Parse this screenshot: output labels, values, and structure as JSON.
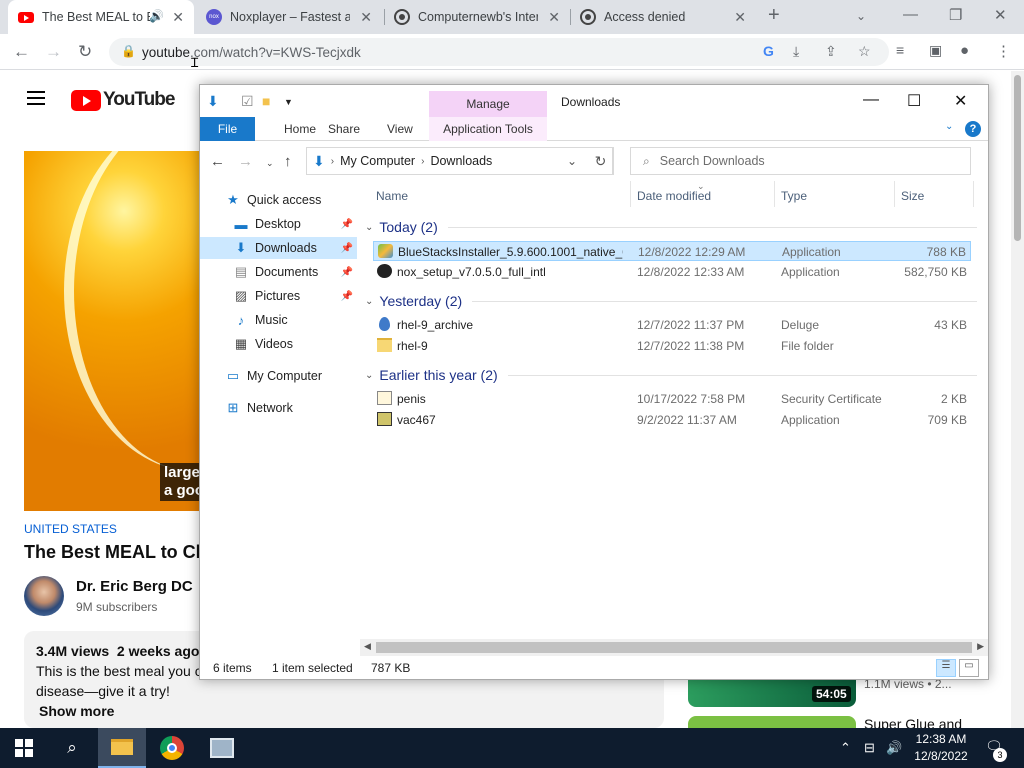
{
  "browser": {
    "tabs": [
      {
        "title": "The Best MEAL to E",
        "active": true
      },
      {
        "title": "Noxplayer – Fastest and",
        "active": false
      },
      {
        "title": "Computernewb's Interne",
        "active": false
      },
      {
        "title": "Access denied",
        "active": false
      }
    ],
    "url_host": "youtube",
    "url_rest": ".com/watch?v=KWS-Tecjxdk"
  },
  "youtube": {
    "logo_text": "YouTube",
    "caption": "large\na goo",
    "country": "UNITED STATES",
    "title": "The Best MEAL to Cl",
    "channel": "Dr. Eric Berg DC",
    "subscribers": "9M subscribers",
    "meta": "3.4M views  2 weeks ago",
    "desc_line1": "This is the best meal you c",
    "desc_line2": "disease—give it a try!",
    "show_more": "Show more",
    "related_duration": "54:05",
    "related_views": "1.1M views  • 2...",
    "related_title": "Super Glue and"
  },
  "explorer": {
    "manage_tab": "Manage",
    "title": "Downloads",
    "ribbon_tabs": [
      "File",
      "Home",
      "Share",
      "View",
      "Application Tools"
    ],
    "breadcrumb": [
      "My Computer",
      "Downloads"
    ],
    "search_placeholder": "Search Downloads",
    "nav_items": [
      {
        "label": "Quick access",
        "icon": "star-icon"
      },
      {
        "label": "Desktop",
        "icon": "desktop-icon"
      },
      {
        "label": "Downloads",
        "icon": "download-icon"
      },
      {
        "label": "Documents",
        "icon": "document-icon"
      },
      {
        "label": "Pictures",
        "icon": "picture-icon"
      },
      {
        "label": "Music",
        "icon": "music-icon"
      },
      {
        "label": "Videos",
        "icon": "video-icon"
      },
      {
        "label": "My Computer",
        "icon": "computer-icon"
      },
      {
        "label": "Network",
        "icon": "network-icon"
      }
    ],
    "columns": [
      "Name",
      "Date modified",
      "Type",
      "Size"
    ],
    "groups": [
      "Today (2)",
      "Yesterday (2)",
      "Earlier this year (2)"
    ],
    "files": [
      {
        "name": "BlueStacksInstaller_5.9.600.1001_native_6...",
        "date": "12/8/2022 12:29 AM",
        "type": "Application",
        "size": "788 KB"
      },
      {
        "name": "nox_setup_v7.0.5.0_full_intl",
        "date": "12/8/2022 12:33 AM",
        "type": "Application",
        "size": "582,750 KB"
      },
      {
        "name": "rhel-9_archive",
        "date": "12/7/2022 11:37 PM",
        "type": "Deluge",
        "size": "43 KB"
      },
      {
        "name": "rhel-9",
        "date": "12/7/2022 11:38 PM",
        "type": "File folder",
        "size": ""
      },
      {
        "name": "penis",
        "date": "10/17/2022 7:58 PM",
        "type": "Security Certificate",
        "size": "2 KB"
      },
      {
        "name": "vac467",
        "date": "9/2/2022 11:37 AM",
        "type": "Application",
        "size": "709 KB"
      }
    ],
    "status_items": "6 items",
    "status_selected": "1 item selected",
    "status_size": "787 KB"
  },
  "taskbar": {
    "time": "12:38 AM",
    "date": "12/8/2022",
    "notifications": "3"
  }
}
